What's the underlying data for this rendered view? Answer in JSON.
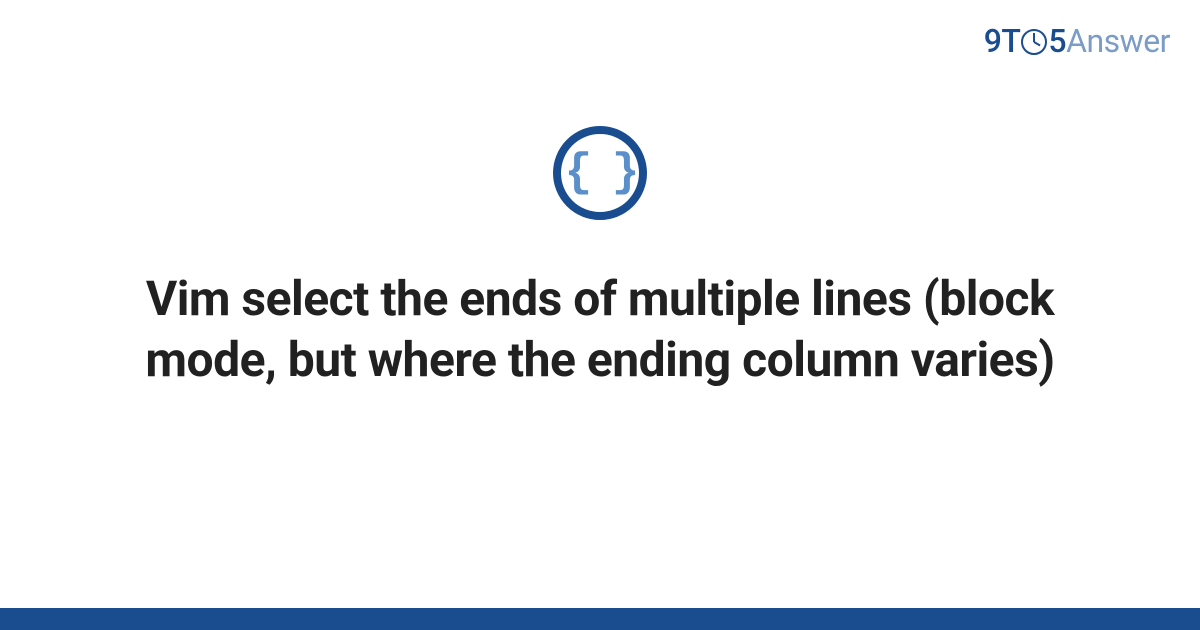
{
  "brand": {
    "part1": "9",
    "part2": "T",
    "part3": "5",
    "part4": "Answer"
  },
  "icon": {
    "glyph": "{ }",
    "name": "code-braces"
  },
  "title": "Vim select the ends of multiple lines (block mode, but where the ending column varies)",
  "colors": {
    "brand_primary": "#1a4d8f",
    "brand_secondary": "#7a9cc6",
    "icon_glyph": "#5a8fc9",
    "title_text": "#212121",
    "background": "#ffffff"
  }
}
